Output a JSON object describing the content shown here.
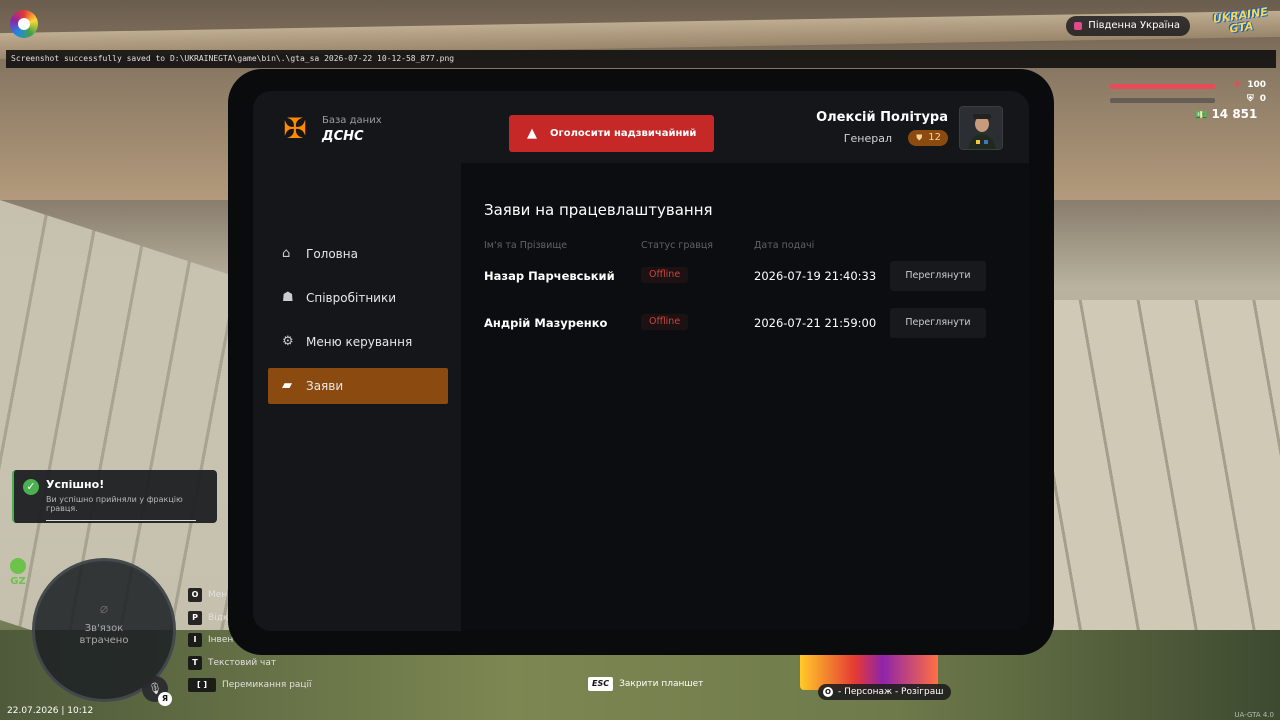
{
  "hud": {
    "screenshot_msg": "Screenshot successfully saved to D:\\UKRAINEGTA\\game\\bin\\.\\gta_sa 2026-07-22 10-12-58_877.png",
    "region": "Південна Україна",
    "logo_line1": "UKRAINE",
    "logo_line2": "GTA",
    "health": "100",
    "armor": "0",
    "money": "14 851",
    "date_time": "22.07.2026 | 10:12",
    "version": "UA-GTA 4.0",
    "gz_label": "GZ",
    "radar_text_line1": "Зв'язок",
    "radar_text_line2": "втрачено",
    "mic_key": "Я",
    "esc_key": "ESC",
    "esc_label": "Закрити планшет",
    "promo_key": "O",
    "promo_label": "- Персонаж - Розіграш",
    "keys": [
      {
        "key": "O",
        "label": "Меню"
      },
      {
        "key": "P",
        "label": "Відк"
      },
      {
        "key": "I",
        "label": "Інвент"
      },
      {
        "key": "T",
        "label": "Текстовий чат"
      },
      {
        "key": "[ ]",
        "label": "Перемикання рації"
      }
    ],
    "colors": {
      "health": "#e84a5a",
      "accent": "#8b4a0f",
      "alert": "#c62828",
      "success": "#4caf50"
    }
  },
  "toast": {
    "title": "Успішно!",
    "message": "Ви успішно прийняли у фракцію гравця."
  },
  "tablet": {
    "brand_sub": "База даних",
    "brand_title": "ДСНС",
    "alert_button": "Оголосити надзвичайний стан",
    "user": {
      "name": "Олексій Політура",
      "rank": "Генерал",
      "rank_level": "12"
    },
    "nav": [
      {
        "label": "Головна",
        "icon": "home-icon",
        "active": false
      },
      {
        "label": "Співробітники",
        "icon": "users-icon",
        "active": false
      },
      {
        "label": "Меню керування",
        "icon": "gear-icon",
        "active": false
      },
      {
        "label": "Заяви",
        "icon": "folder-icon",
        "active": true
      }
    ],
    "content": {
      "title": "Заяви на працевлаштування",
      "columns": [
        "Ім'я та Прізвище",
        "Статус гравця",
        "Дата подачі"
      ],
      "rows": [
        {
          "name": "Назар Парчевський",
          "status": "Offline",
          "date": "2026-07-19 21:40:33",
          "action": "Переглянути"
        },
        {
          "name": "Андрій Мазуренко",
          "status": "Offline",
          "date": "2026-07-21 21:59:00",
          "action": "Переглянути"
        }
      ]
    }
  }
}
